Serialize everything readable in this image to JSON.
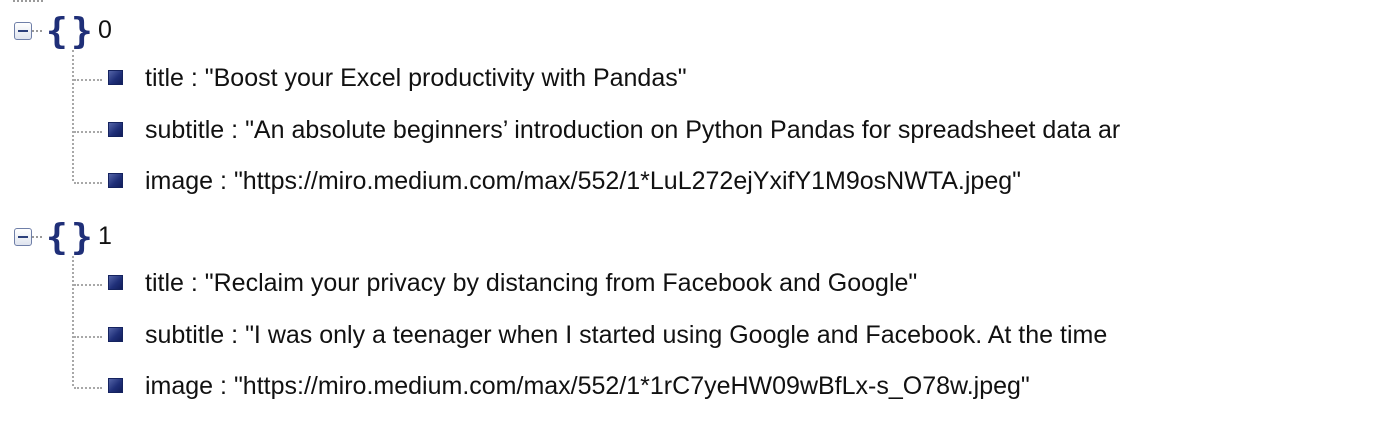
{
  "tree": {
    "separator": " : ",
    "nodes": [
      {
        "key": "0",
        "fields": [
          {
            "name": "title",
            "value": "\"Boost your Excel productivity with Pandas\""
          },
          {
            "name": "subtitle",
            "value": "\"An absolute beginners’ introduction on Python Pandas for spreadsheet data ar"
          },
          {
            "name": "image",
            "value": "\"https://miro.medium.com/max/552/1*LuL272ejYxifY1M9osNWTA.jpeg\""
          }
        ]
      },
      {
        "key": "1",
        "fields": [
          {
            "name": "title",
            "value": "\"Reclaim your privacy by distancing from Facebook and Google\""
          },
          {
            "name": "subtitle",
            "value": "\"I was only a teenager when I started using Google and Facebook. At the time"
          },
          {
            "name": "image",
            "value": "\"https://miro.medium.com/max/552/1*1rC7yeHW09wBfLx-s_O78w.jpeg\""
          }
        ]
      }
    ]
  },
  "colors": {
    "icon_blue": "#1f2f78",
    "connector_gray": "#a8a8a8",
    "text": "#111111"
  },
  "icons": {
    "object": "object-braces-icon",
    "toggle": "collapse-toggle-icon",
    "property": "property-square-icon"
  }
}
